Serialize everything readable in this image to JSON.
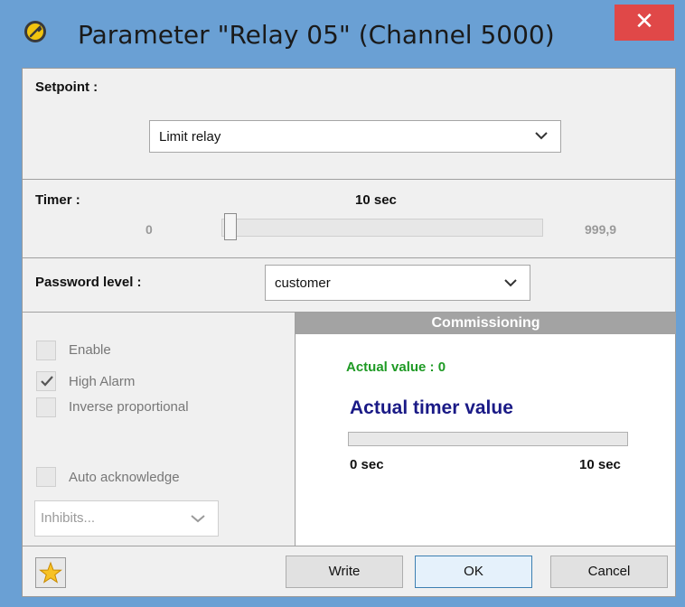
{
  "window": {
    "title": "Parameter \"Relay 05\" (Channel 5000)",
    "close_glyph": "✕",
    "icon": "wrench-icon"
  },
  "setpoint": {
    "label": "Setpoint :",
    "selected": "Limit relay"
  },
  "timer": {
    "label": "Timer :",
    "value_text": "10 sec",
    "min": "0",
    "max": "999,9",
    "slider_value": 0
  },
  "password": {
    "label": "Password level :",
    "selected": "customer"
  },
  "options": {
    "enable": {
      "label": "Enable",
      "checked": false
    },
    "high_alarm": {
      "label": "High Alarm",
      "checked": true
    },
    "inverse_proportional": {
      "label": "Inverse proportional",
      "checked": false
    },
    "auto_acknowledge": {
      "label": "Auto acknowledge",
      "checked": false
    },
    "inhibits": {
      "placeholder": "Inhibits..."
    }
  },
  "commissioning": {
    "header": "Commissioning",
    "actual_value": "Actual value : 0",
    "actual_timer_title": "Actual timer value",
    "progress_fraction": 0,
    "min_label": "0 sec",
    "max_label": "10 sec"
  },
  "buttons": {
    "write": "Write",
    "ok": "OK",
    "cancel": "Cancel",
    "favorite_icon": "star-icon"
  },
  "colors": {
    "window_frame": "#6aa0d4",
    "close": "#e04848",
    "actual_value": "#1e9a24",
    "timer_title": "#1a1a86",
    "commissioning_header": "#a3a3a3"
  }
}
